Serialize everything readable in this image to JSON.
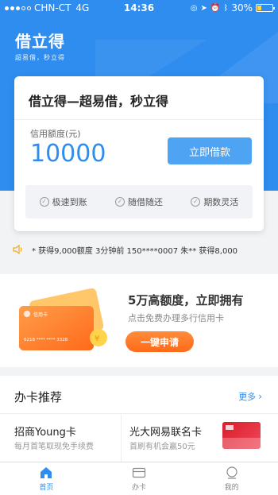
{
  "status_bar": {
    "carrier": "CHN-CT",
    "network": "4G",
    "time": "14:36",
    "battery": "30%",
    "battery_level": 0.3
  },
  "brand": {
    "name": "借立得",
    "slogan": "超易借，秒立得"
  },
  "loan_card": {
    "title": "借立得—超易借，秒立得",
    "limit_label": "信用额度(元)",
    "limit_value": "10000",
    "borrow_button": "立即借款",
    "features": [
      "极速到账",
      "随借随还",
      "期数灵活"
    ]
  },
  "notice": {
    "text": "* 获得9,000额度    3分钟前 150****0007 朱** 获得8,000"
  },
  "promo": {
    "headline": "5万高额度，立即拥有",
    "subtext": "点击免费办理多行信用卡",
    "button": "一键申请",
    "card_bank": "信用卡",
    "card_number": "6218 **** **** 3328"
  },
  "recommend": {
    "title": "办卡推荐",
    "more": "更多",
    "items": [
      {
        "title": "招商Young卡",
        "subtitle": "每月首笔取现免手续费"
      },
      {
        "title": "光大网易联名卡",
        "subtitle": "首刷有机会赢50元"
      }
    ]
  },
  "tabs": [
    {
      "label": "首页",
      "icon": "home-icon",
      "active": true
    },
    {
      "label": "办卡",
      "icon": "card-icon",
      "active": false
    },
    {
      "label": "我的",
      "icon": "profile-icon",
      "active": false
    }
  ],
  "colors": {
    "primary": "#2f8df0",
    "accent_orange": "#ff6a1a"
  }
}
